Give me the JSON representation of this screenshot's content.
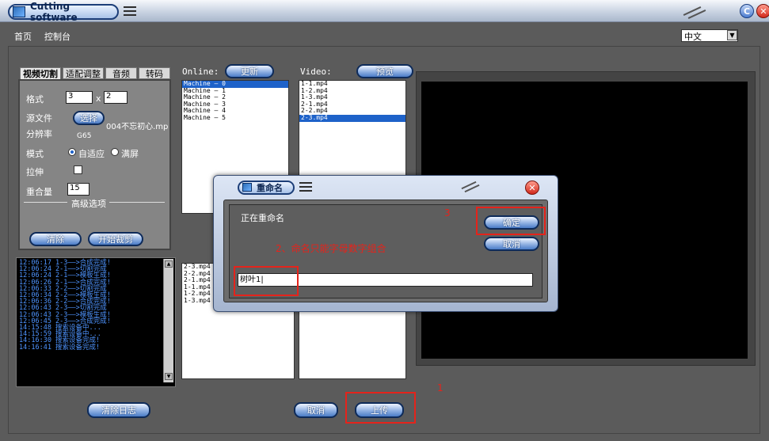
{
  "window": {
    "title": "Cutting software"
  },
  "nav": {
    "home": "首页",
    "console": "控制台",
    "language": "中文"
  },
  "tabs": [
    "视频切割",
    "适配调整",
    "音频",
    "转码"
  ],
  "panel": {
    "format_label": "格式",
    "format_w": "3",
    "format_x": "x",
    "format_h": "2",
    "source_label": "源文件",
    "select_button": "选择",
    "source_value": "004不忘初心.mp",
    "resolution_label": "分辨率",
    "resolution_value": "G65",
    "mode_label": "模式",
    "mode_adaptive": "自适应",
    "mode_fullscreen": "满屏",
    "stretch_label": "拉伸",
    "overlap_label": "重合量",
    "overlap_value": "15",
    "advanced": "高级选项",
    "clear_button": "清除",
    "start_button": "开始裁剪"
  },
  "online": {
    "label": "Online:",
    "update_button": "更新",
    "machines": [
      "Machine — 0",
      "Machine — 1",
      "Machine — 2",
      "Machine — 3",
      "Machine — 4",
      "Machine — 5"
    ],
    "selected_index": 0
  },
  "video": {
    "label": "Video:",
    "preview_button": "预览",
    "files": [
      "1-1.mp4",
      "1-2.mp4",
      "1-3.mp4",
      "2-1.mp4",
      "2-2.mp4",
      "2-3.mp4"
    ],
    "selected_index": 5
  },
  "upload_list": [
    "2-3.mp4",
    "2-2.mp4",
    "2-1.mp4",
    "1-1.mp4",
    "1-2.mp4",
    "1-3.mp4"
  ],
  "log": [
    "12:06:17 1-3——>合成完成!",
    "12:06:24 2-1——>切割完成",
    "12:06:24 2-1——>模板生成!",
    "12:06:26 2-1——>合成完成!",
    "12:06:33 2-2——>切割完成",
    "12:06:34 2-2——>模板生成!",
    "12:06:36 2-2——>合成完成!",
    "12:06:43 2-3——>切割完成",
    "12:06:43 2-3——>模板生成!",
    "12:06:45 2-3——>合成完成!",
    "14:15:48 搜索设备中...",
    "14:15:59 搜索设备中...",
    "14:16:30 搜索设备完成!",
    "14:16:41 搜索设备完成!"
  ],
  "bottom": {
    "clear_log": "清除日志",
    "cancel": "取消",
    "upload": "上传"
  },
  "dialog": {
    "title": "重命名",
    "status": "正在重命名",
    "confirm": "确定",
    "cancel": "取消",
    "name_value": "树叶1|"
  },
  "annotations": {
    "step1": "1",
    "step2": "2、命名只能字母数字组合",
    "step3": "3"
  },
  "colors": {
    "accent": "#1e62c9",
    "annotation": "#e5231b",
    "log_text": "#4e94ff"
  }
}
